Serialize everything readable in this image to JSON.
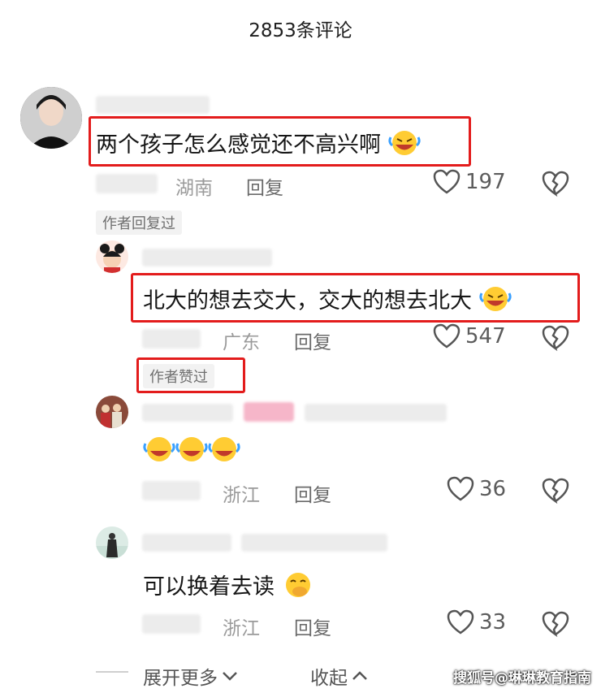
{
  "header": {
    "title": "2853条评论"
  },
  "comments": [
    {
      "text": "两个孩子怎么感觉还不高兴啊",
      "emoji": "laughing-crying-emoji",
      "location": "湖南",
      "reply_label": "回复",
      "likes": "197",
      "author_tag": "作者回复过"
    },
    {
      "text": "北大的想去交大，交大的想去北大",
      "emoji": "laughing-crying-emoji",
      "location": "广东",
      "reply_label": "回复",
      "likes": "547",
      "author_tag": "作者赞过"
    },
    {
      "text": "",
      "emoji": "laughing-crying-emoji",
      "location": "浙江",
      "reply_label": "回复",
      "likes": "36"
    },
    {
      "text": "可以换着去读",
      "emoji": "giggle-emoji",
      "location": "浙江",
      "reply_label": "回复",
      "likes": "33"
    }
  ],
  "footer": {
    "expand_label": "展开更多",
    "collapse_label": "收起"
  },
  "watermark": "搜狐号@琳琳教育指南",
  "colors": {
    "highlight_box": "#e31c1c",
    "meta_text": "#9b9b9b"
  }
}
